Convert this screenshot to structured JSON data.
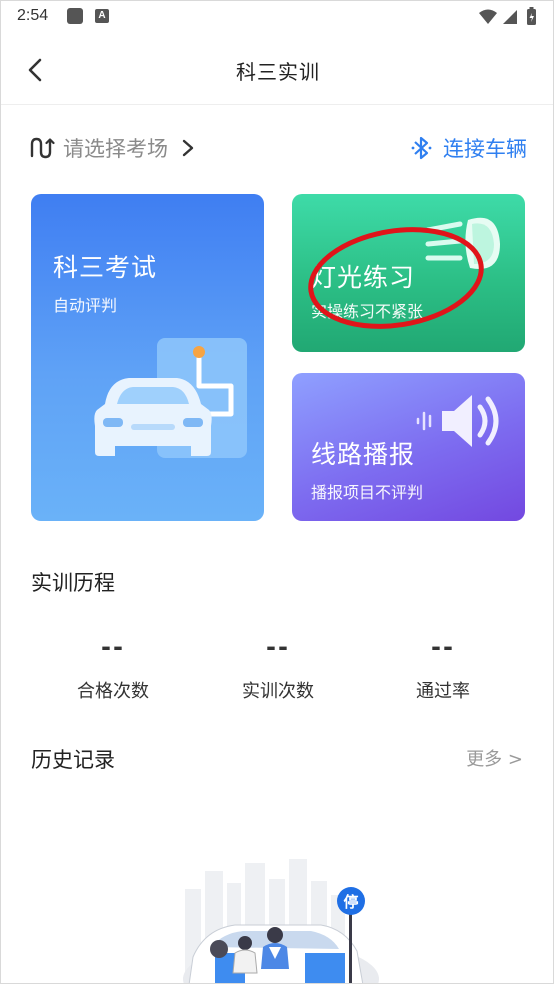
{
  "status_bar": {
    "time": "2:54",
    "a_badge": "A"
  },
  "header": {
    "title": "科三实训"
  },
  "site_row": {
    "select_label": "请选择考场",
    "connect_label": "连接车辆"
  },
  "cards": {
    "exam": {
      "title": "科三考试",
      "subtitle": "自动评判"
    },
    "light": {
      "title": "灯光练习",
      "subtitle": "实操练习不紧张"
    },
    "route": {
      "title": "线路播报",
      "subtitle": "播报项目不评判"
    }
  },
  "history": {
    "title": "实训历程",
    "stats": [
      {
        "value": "--",
        "label": "合格次数"
      },
      {
        "value": "--",
        "label": "实训次数"
      },
      {
        "value": "--",
        "label": "通过率"
      }
    ]
  },
  "records": {
    "title": "历史记录",
    "more_label": "更多 >"
  },
  "illustration": {
    "parking_sign": "停"
  },
  "colors": {
    "accent": "#2f7ff0",
    "annotation_circle": "#e0141a"
  },
  "icons": [
    "back-arrow-icon",
    "route-icon",
    "chevron-right-icon",
    "bluetooth-icon",
    "car-icon",
    "headlight-icon",
    "speaker-icon",
    "wifi-icon",
    "signal-icon",
    "battery-icon"
  ]
}
